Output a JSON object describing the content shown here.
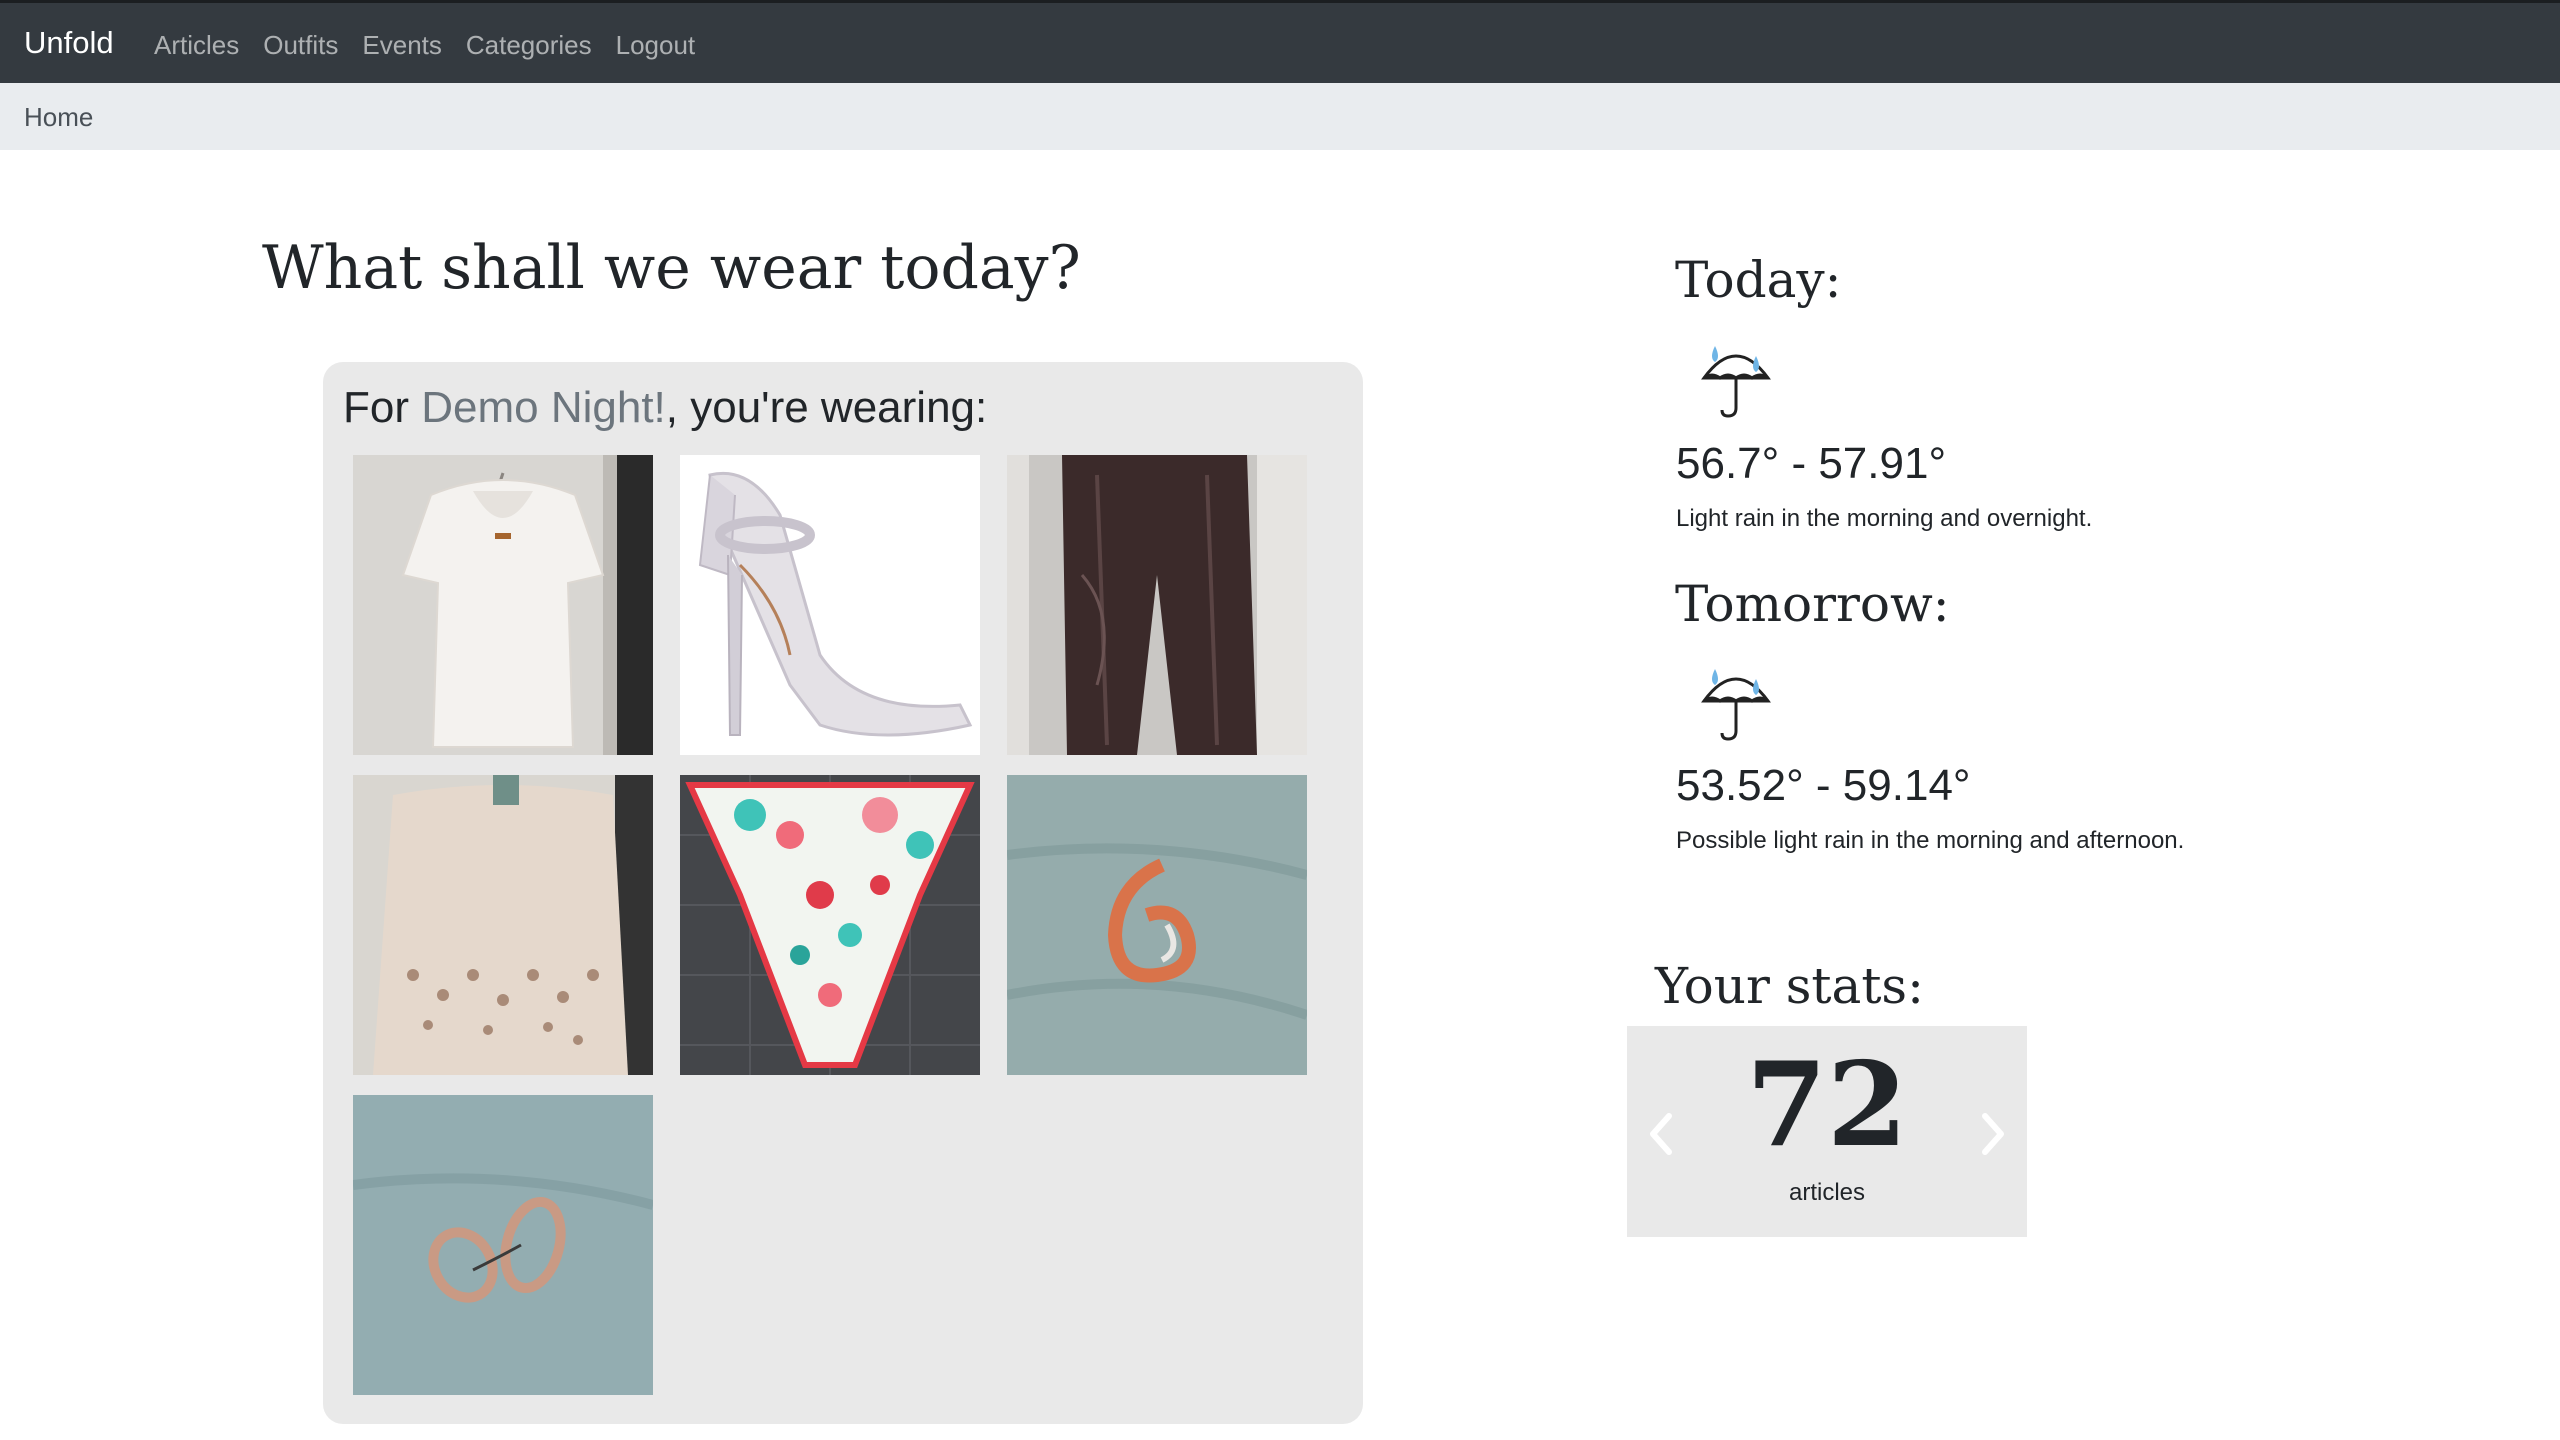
{
  "navbar": {
    "brand": "Unfold",
    "links": [
      "Articles",
      "Outfits",
      "Events",
      "Categories",
      "Logout"
    ]
  },
  "breadcrumb": {
    "current": "Home"
  },
  "main": {
    "title": "What shall we wear today?",
    "outfit": {
      "prefix": "For ",
      "event_name": "Demo Night!",
      "suffix": ", you're wearing:",
      "articles": [
        "white-blouse-photo-icon",
        "silver-heels-photo-icon",
        "leather-pants-photo-icon",
        "lace-cardigan-photo-icon",
        "floral-scarf-photo-icon",
        "brooch-photo-icon",
        "earrings-photo-icon"
      ]
    }
  },
  "weather": {
    "today": {
      "heading": "Today:",
      "icon": "rain-umbrella-icon",
      "temp": "56.7° - 57.91°",
      "summary": "Light rain in the morning and overnight."
    },
    "tomorrow": {
      "heading": "Tomorrow:",
      "icon": "rain-umbrella-icon",
      "temp": "53.52° - 59.14°",
      "summary": "Possible light rain in the morning and afternoon."
    }
  },
  "stats": {
    "heading": "Your stats:",
    "value": "72",
    "label": "articles"
  },
  "colors": {
    "navbar_bg": "#343a40",
    "breadcrumb_bg": "#e9ecef",
    "card_bg": "#e9e9e9",
    "event_link": "#6c757d"
  }
}
